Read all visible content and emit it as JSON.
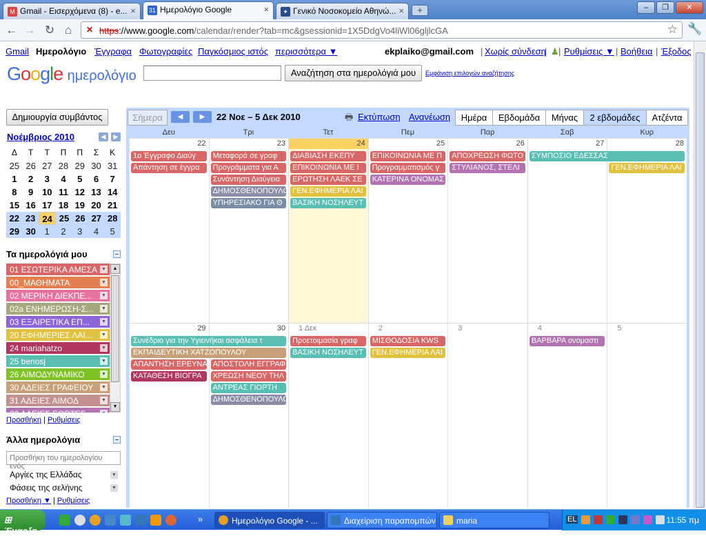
{
  "browser": {
    "tabs": [
      {
        "label": "Gmail - Εισερχόμενα (8) - e...",
        "icon": "gmail-icon",
        "color": "#d44"
      },
      {
        "label": "Ημερολόγιο Google",
        "icon": "calendar-31-icon",
        "color": "#36c",
        "icon_text": "31"
      },
      {
        "label": "Γενικό Νοσοκομείο Αθηνώ...",
        "icon": "hospital-icon",
        "color": "#2a4a8a"
      }
    ],
    "url_scheme": "https",
    "url_host": "://www.google.com",
    "url_path": "/calendar/render?tab=mc&gsessionid=1X5DdgVo4liWl06gljlcGA"
  },
  "gbar": {
    "gmail": "Gmail",
    "calendar": "Ημερολόγιο",
    "docs": "Έγγραφα",
    "photos": "Φωτογραφίες",
    "web": "Παγκόσμιος ιστός",
    "more": "περισσότερα ▼",
    "email": "ekplaiko@gmail.com",
    "offline": "Χωρίς σύνδεση",
    "settings": "Ρυθμίσεις ▼",
    "help": "Βοήθεια",
    "signout": "Έξοδος"
  },
  "header": {
    "logo_google": "Google",
    "logo_calendar": "ημερολόγιο",
    "search_button": "Αναζήτηση στα ημερολόγιά μου",
    "search_options": "Εμφάνιση επιλογών αναζήτησης"
  },
  "sidebar": {
    "create_event": "Δημιουργία συμβάντος",
    "month_title": "Νοέμβριος 2010",
    "weekdays": [
      "Δ",
      "Τ",
      "Τ",
      "Π",
      "Π",
      "Σ",
      "Κ"
    ],
    "mini_weeks": [
      [
        "25",
        "26",
        "27",
        "28",
        "29",
        "30",
        "31"
      ],
      [
        "1",
        "2",
        "3",
        "4",
        "5",
        "6",
        "7"
      ],
      [
        "8",
        "9",
        "10",
        "11",
        "12",
        "13",
        "14"
      ],
      [
        "15",
        "16",
        "17",
        "18",
        "19",
        "20",
        "21"
      ],
      [
        "22",
        "23",
        "24",
        "25",
        "26",
        "27",
        "28"
      ],
      [
        "29",
        "30",
        "1",
        "2",
        "3",
        "4",
        "5"
      ]
    ],
    "my_calendars_title": "Τα ημερολόγιά μου",
    "my_calendars": [
      {
        "name": "01 ΕΣΩΤΕΡΙΚΑ ΑΜΕΣΑ",
        "color": "#d96666"
      },
      {
        "name": "00_ΜΑΘΗΜΑΤΑ",
        "color": "#e67f4f"
      },
      {
        "name": "02 ΜΕΡΙΚΗ ΔΙΕΚΠΕ...",
        "color": "#e6739f"
      },
      {
        "name": "02a ΕΝΗΜΕΡΩΣΗ-Σ...",
        "color": "#a7a77d"
      },
      {
        "name": "03 ΕΞΑΙΡΕΤΙΚΑ ΕΠ...",
        "color": "#8c66d9"
      },
      {
        "name": "20 ΕΦΗΜΕΡΙΕΣ ΛΑΙ...",
        "color": "#e0c240"
      },
      {
        "name": "24 mariahatzo",
        "color": "#b1365f"
      },
      {
        "name": "25 benosj",
        "color": "#59bfb3"
      },
      {
        "name": "26 ΑΙΜΟΔΥΝΑΜΙΚΟ",
        "color": "#7ec225"
      },
      {
        "name": "30 ΑΔΕΙΕΣ ΓΡΑΦΕΙΟΥ",
        "color": "#c7a07a"
      },
      {
        "name": "31 ΑΔΕΙΕΣ ΑΙΜΟΔ",
        "color": "#c48f8f"
      },
      {
        "name": "32 ΑΔΕΙΕΣ ΕΟΡΤΕΣ",
        "color": "#b373b3"
      }
    ],
    "add_link": "Προσθήκη",
    "settings_link": "Ρυθμίσεις",
    "other_calendars_title": "Άλλα ημερολόγια",
    "add_calendar_placeholder": "Προσθήκη του ημερολογίου ενός",
    "other_calendars": [
      "Αργίες της Ελλάδας",
      "Φάσεις της σελήνης"
    ],
    "add_link2": "Προσθήκη ▼"
  },
  "calendar": {
    "today_button": "Σήμερα",
    "date_range": "22 Νοε – 5 Δεκ 2010",
    "print": "Εκτύπωση",
    "refresh": "Ανανέωση",
    "views": [
      "Ημέρα",
      "Εβδομάδα",
      "Μήνας",
      "2 εβδομάδες",
      "Ατζέντα"
    ],
    "weekdays": [
      "Δευ",
      "Τρι",
      "Τετ",
      "Πεμ",
      "Παρ",
      "Σαβ",
      "Κυρ"
    ],
    "week1_days": [
      "22",
      "23",
      "24",
      "25",
      "26",
      "27",
      "28"
    ],
    "week2_days": [
      "29",
      "30",
      "1 Δεκ",
      "2",
      "3",
      "4",
      "5"
    ],
    "week1_events": [
      {
        "day": 0,
        "row": 0,
        "text": "1ο Έγγραφο Διαύγ",
        "color": "#d96666"
      },
      {
        "day": 0,
        "row": 1,
        "text": "Απάντηση σε έγγρα",
        "color": "#d96666"
      },
      {
        "day": 1,
        "row": 0,
        "text": "Μεταφορά σε γραφ",
        "color": "#d96666"
      },
      {
        "day": 1,
        "row": 1,
        "text": "Προγράμματα για Α",
        "color": "#d96666"
      },
      {
        "day": 1,
        "row": 2,
        "text": "Συνάντηση Διαύγεια",
        "color": "#d96666"
      },
      {
        "day": 1,
        "row": 3,
        "text": "ΔΗΜΟΣΘΕΝΟΠΟΥΛΟ",
        "color": "#8c8ca6"
      },
      {
        "day": 1,
        "row": 4,
        "text": "ΥΠΗΡΕΣΙΑΚΟ ΓΙΑ Θ",
        "color": "#7a8ca6"
      },
      {
        "day": 2,
        "row": 0,
        "text": "ΔΙΑΒΙΑΣΗ ΕΚΕΠΥ",
        "color": "#d96666"
      },
      {
        "day": 2,
        "row": 1,
        "text": "ΕΠΙΚΟΙΝΩΝΙΑ ΜΕ Ι",
        "color": "#d96666"
      },
      {
        "day": 2,
        "row": 2,
        "text": "ΕΡΩΤΗΣΗ ΛΑΕΚ ΣΕ",
        "color": "#d96666"
      },
      {
        "day": 2,
        "row": 3,
        "text": "ΓΕΝ.ΕΦΗΜΕΡΙΑ ΛΑΙ",
        "color": "#e0c240"
      },
      {
        "day": 2,
        "row": 4,
        "text": "ΒΑΣΙΚΗ ΝΟΣΗΛΕΥΤ",
        "color": "#59bfb3"
      },
      {
        "day": 3,
        "row": 0,
        "text": "ΕΠΙΚΟΙΝΩΝΙΑ ΜΕ Π",
        "color": "#d96666"
      },
      {
        "day": 3,
        "row": 1,
        "text": "Προγραμματισμός γ",
        "color": "#d96666"
      },
      {
        "day": 3,
        "row": 2,
        "text": "ΚΑΤΕΡΙΝΑ ΟΝΟΜΑΣ",
        "color": "#b373b3"
      },
      {
        "day": 4,
        "row": 0,
        "text": "ΑΠΟΧΡΕΩΣΗ ΦΩΤΟ",
        "color": "#d96666"
      },
      {
        "day": 4,
        "row": 1,
        "text": "ΣΤΥΛΙΑΝΟΣ, ΣΤΕΛΙ",
        "color": "#b373b3"
      },
      {
        "day": 5,
        "row": 0,
        "text": "ΣΥΜΠΟΣΙΟ ΕΔΕΣΣΑΣ",
        "color": "#59bfb3",
        "span": 2
      },
      {
        "day": 6,
        "row": 1,
        "text": "ΓΕΝ.ΕΦΗΜΕΡΙΑ ΛΑΙ",
        "color": "#e0c240"
      }
    ],
    "week2_events": [
      {
        "day": 0,
        "row": 0,
        "text": "Συνέδριο για την Υγιεινήκαι ασφάλεια τ",
        "color": "#59bfb3",
        "span": 2
      },
      {
        "day": 0,
        "row": 1,
        "text": "ΕΚΠΑΙΔΕΥΤΙΚΗ ΧΑΤΖΟΠΟΥΛΟΥ",
        "color": "#c7a07a",
        "span": 2
      },
      {
        "day": 0,
        "row": 2,
        "text": "ΑΠΑΝΤΗΣΗ ΕΡΕΥΝΑ",
        "color": "#d96666"
      },
      {
        "day": 0,
        "row": 3,
        "text": "ΚΑΤΑΘΕΣΗ ΒΙΟΓΡΑ",
        "color": "#b1365f"
      },
      {
        "day": 1,
        "row": 2,
        "text": "ΑΠΟΣΤΟΛΗ ΕΓΓΡΑΦ",
        "color": "#d96666"
      },
      {
        "day": 1,
        "row": 3,
        "text": "ΧΡΕΩΣΗ ΝΕΟΥ ΤΗΛ",
        "color": "#d96666"
      },
      {
        "day": 1,
        "row": 4,
        "text": "ΑΝΤΡΕΑΣ ΓΙΟΡΤΗ",
        "color": "#59bfb3"
      },
      {
        "day": 1,
        "row": 5,
        "text": "ΔΗΜΟΣΘΕΝΟΠΟΥΛΟ",
        "color": "#8c8ca6"
      },
      {
        "day": 2,
        "row": 0,
        "text": "Προετοιμασία γραφ",
        "color": "#d96666"
      },
      {
        "day": 2,
        "row": 1,
        "text": "ΒΑΣΙΚΗ ΝΟΣΗΛΕΥΤ",
        "color": "#59bfb3"
      },
      {
        "day": 3,
        "row": 0,
        "text": "ΜΙΣΘΟΔΟΣΙΑ KWS",
        "color": "#d96666"
      },
      {
        "day": 3,
        "row": 1,
        "text": "ΓΕΝ.ΕΦΗΜΕΡΙΑ ΛΑΙ",
        "color": "#e0c240"
      },
      {
        "day": 5,
        "row": 0,
        "text": "ΒΑΡΒΑΡΑ ονομαστι",
        "color": "#b373b3"
      }
    ]
  },
  "taskbar": {
    "start": "Έναρξη",
    "tasks": [
      {
        "label": "Ημερολόγιο Google - ...",
        "active": true
      },
      {
        "label": "Διαχείριση παραπομπών....",
        "active": false
      },
      {
        "label": "maria",
        "active": false
      }
    ],
    "lang": "EL",
    "time": "11:55 πμ"
  }
}
